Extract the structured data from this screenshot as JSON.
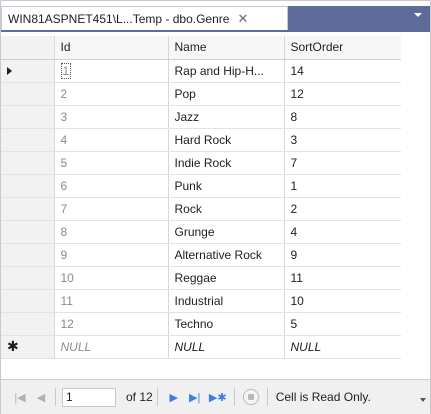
{
  "tab": {
    "title": "WIN81ASPNET451\\L...Temp - dbo.Genre",
    "close_glyph": "✕"
  },
  "grid": {
    "columns": [
      "Id",
      "Name",
      "SortOrder"
    ],
    "rows": [
      {
        "id": "1",
        "name": "Rap and Hip-H...",
        "sort": "14"
      },
      {
        "id": "2",
        "name": "Pop",
        "sort": "12"
      },
      {
        "id": "3",
        "name": "Jazz",
        "sort": "8"
      },
      {
        "id": "4",
        "name": "Hard Rock",
        "sort": "3"
      },
      {
        "id": "5",
        "name": "Indie Rock",
        "sort": "7"
      },
      {
        "id": "6",
        "name": "Punk",
        "sort": "1"
      },
      {
        "id": "7",
        "name": "Rock",
        "sort": "2"
      },
      {
        "id": "8",
        "name": "Grunge",
        "sort": "4"
      },
      {
        "id": "9",
        "name": "Alternative Rock",
        "sort": "9"
      },
      {
        "id": "10",
        "name": "Reggae",
        "sort": "11"
      },
      {
        "id": "11",
        "name": "Industrial",
        "sort": "10"
      },
      {
        "id": "12",
        "name": "Techno",
        "sort": "5"
      }
    ],
    "new_row": {
      "marker": "✱",
      "id": "NULL",
      "name": "NULL",
      "sort": "NULL"
    },
    "current_row_marker": "▶"
  },
  "navigation": {
    "current_record": "1",
    "of_text": "of 12",
    "status_text": "Cell is Read Only."
  },
  "colors": {
    "tab_accent": "#5c6b9a",
    "nav_arrow": "#3b7fe0",
    "id_text": "#8a8a8a"
  }
}
